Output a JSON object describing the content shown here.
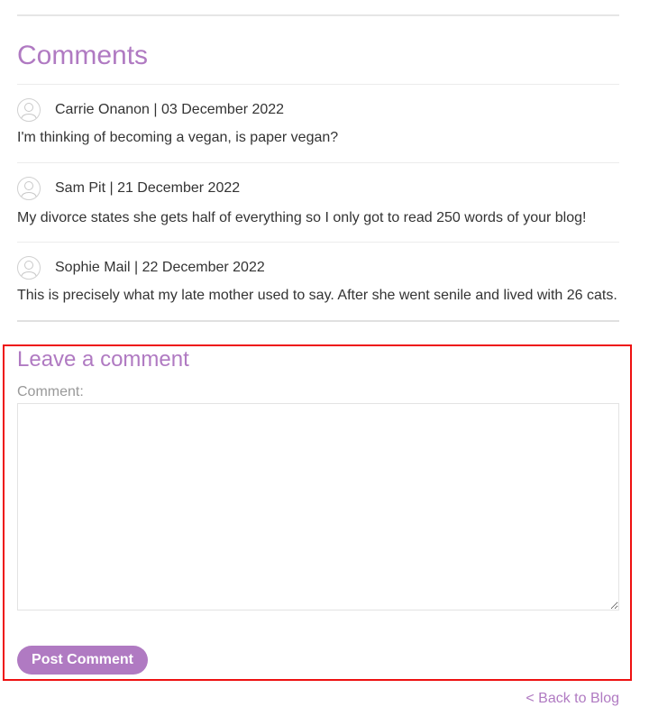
{
  "comments_section": {
    "title": "Comments",
    "items": [
      {
        "author_line": "Carrie Onanon | 03 December 2022",
        "body": "I'm thinking of becoming a vegan, is paper vegan?",
        "avatar_icon": "user-avatar-icon"
      },
      {
        "author_line": "Sam Pit | 21 December 2022",
        "body": "My divorce states she gets half of everything so I only got to read 250 words of your blog!",
        "avatar_icon": "user-avatar-icon"
      },
      {
        "author_line": "Sophie Mail | 22 December 2022",
        "body": "This is precisely what my late mother used to say. After she went senile and lived with 26 cats.",
        "avatar_icon": "user-avatar-icon"
      }
    ]
  },
  "leave_comment": {
    "title": "Leave a comment",
    "comment_label": "Comment:",
    "comment_value": "",
    "submit_label": "Post Comment"
  },
  "footer": {
    "back_link": "< Back to Blog"
  },
  "colors": {
    "accent": "#b07ac2",
    "highlight_border": "#ee1111",
    "text": "#333333",
    "muted": "#999999"
  }
}
